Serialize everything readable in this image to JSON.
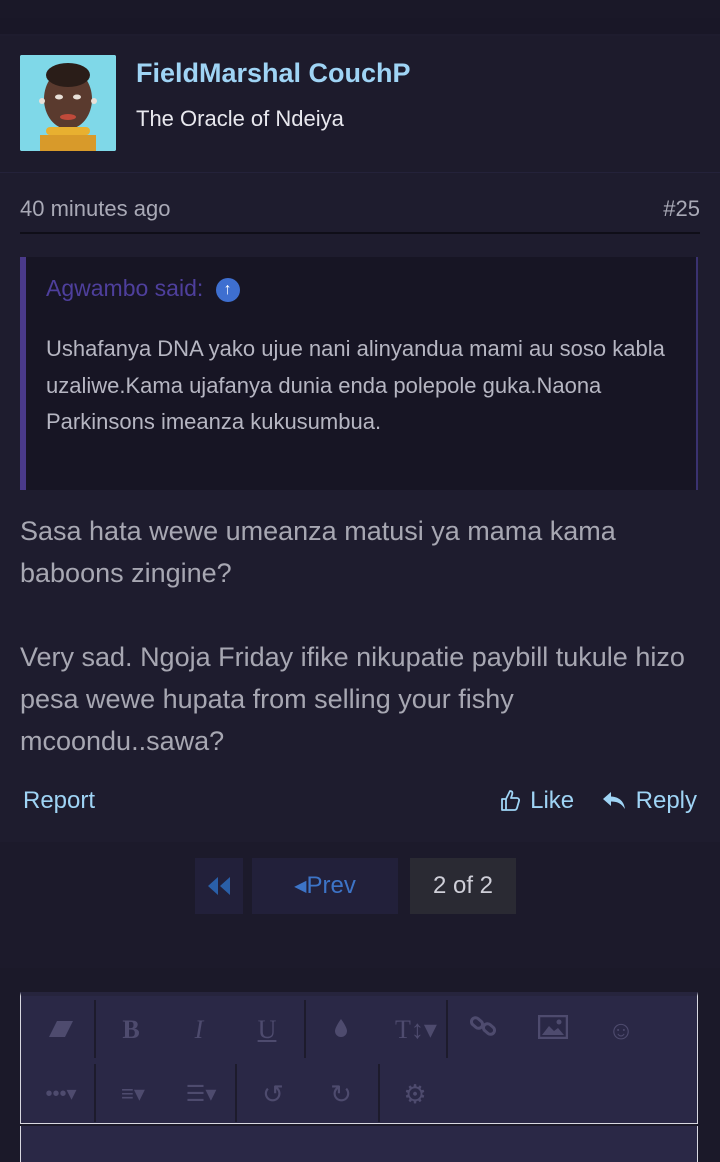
{
  "post": {
    "username": "FieldMarshal CouchP",
    "user_title": "The Oracle of Ndeiya",
    "time": "40 minutes ago",
    "post_number": "#25"
  },
  "quote": {
    "author": "Agwambo said:",
    "text": "Ushafanya DNA yako ujue nani alinyandua mami au soso kabla uzaliwe.Kama ujafanya dunia enda polepole guka.Naona Parkinsons imeanza kukusumbua."
  },
  "message": {
    "paragraph1": "Sasa hata wewe umeanza matusi ya mama kama baboons zingine?",
    "paragraph2": "Very sad. Ngoja Friday ifike nikupatie paybill tukule hizo pesa wewe hupata from selling your fishy mcoondu..sawa?"
  },
  "actions": {
    "report": "Report",
    "like": "Like",
    "reply": "Reply"
  },
  "pagination": {
    "prev": "Prev",
    "current": "2 of 2"
  },
  "icons": {
    "quote_jump": "arrow-up-circle-icon",
    "like": "thumbs-up-icon",
    "reply": "reply-arrow-icon",
    "first": "double-chevron-left-icon",
    "prev": "caret-left-icon"
  },
  "colors": {
    "background": "#1c1a2b",
    "link": "#9fd4f5",
    "quote_accent": "#4a3a8a",
    "pager_link": "#3d74c7"
  }
}
